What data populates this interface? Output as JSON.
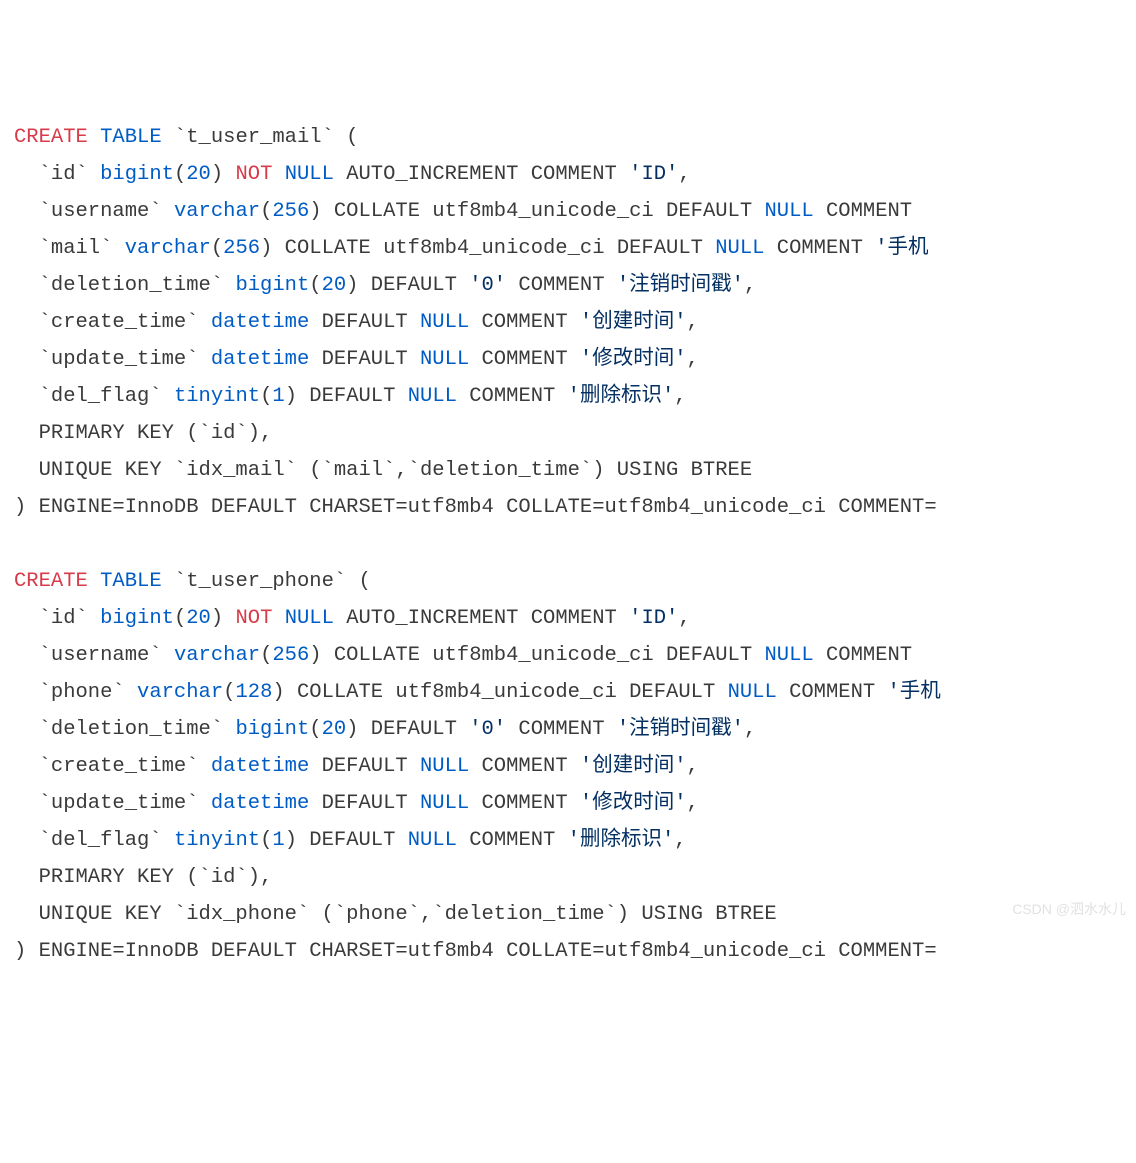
{
  "lines": [
    [
      {
        "c": "k-create",
        "t": "CREATE"
      },
      {
        "c": "plain",
        "t": " "
      },
      {
        "c": "k-blue",
        "t": "TABLE"
      },
      {
        "c": "plain",
        "t": " `t_user_mail` ("
      }
    ],
    [
      {
        "c": "plain",
        "t": "  `id` "
      },
      {
        "c": "k-blue",
        "t": "bigint"
      },
      {
        "c": "plain",
        "t": "("
      },
      {
        "c": "k-blue",
        "t": "20"
      },
      {
        "c": "plain",
        "t": ") "
      },
      {
        "c": "k-create",
        "t": "NOT"
      },
      {
        "c": "plain",
        "t": " "
      },
      {
        "c": "k-blue",
        "t": "NULL"
      },
      {
        "c": "plain",
        "t": " AUTO_INCREMENT COMMENT "
      },
      {
        "c": "k-str",
        "t": "'ID'"
      },
      {
        "c": "plain",
        "t": ","
      }
    ],
    [
      {
        "c": "plain",
        "t": "  `username` "
      },
      {
        "c": "k-blue",
        "t": "varchar"
      },
      {
        "c": "plain",
        "t": "("
      },
      {
        "c": "k-blue",
        "t": "256"
      },
      {
        "c": "plain",
        "t": ") COLLATE utf8mb4_unicode_ci DEFAULT "
      },
      {
        "c": "k-blue",
        "t": "NULL"
      },
      {
        "c": "plain",
        "t": " COMMENT "
      }
    ],
    [
      {
        "c": "plain",
        "t": "  `mail` "
      },
      {
        "c": "k-blue",
        "t": "varchar"
      },
      {
        "c": "plain",
        "t": "("
      },
      {
        "c": "k-blue",
        "t": "256"
      },
      {
        "c": "plain",
        "t": ") COLLATE utf8mb4_unicode_ci DEFAULT "
      },
      {
        "c": "k-blue",
        "t": "NULL"
      },
      {
        "c": "plain",
        "t": " COMMENT "
      },
      {
        "c": "k-str",
        "t": "'手机"
      }
    ],
    [
      {
        "c": "plain",
        "t": "  `deletion_time` "
      },
      {
        "c": "k-blue",
        "t": "bigint"
      },
      {
        "c": "plain",
        "t": "("
      },
      {
        "c": "k-blue",
        "t": "20"
      },
      {
        "c": "plain",
        "t": ") DEFAULT "
      },
      {
        "c": "k-str",
        "t": "'0'"
      },
      {
        "c": "plain",
        "t": " COMMENT "
      },
      {
        "c": "k-str",
        "t": "'注销时间戳'"
      },
      {
        "c": "plain",
        "t": ","
      }
    ],
    [
      {
        "c": "plain",
        "t": "  `create_time` "
      },
      {
        "c": "k-blue",
        "t": "datetime"
      },
      {
        "c": "plain",
        "t": " DEFAULT "
      },
      {
        "c": "k-blue",
        "t": "NULL"
      },
      {
        "c": "plain",
        "t": " COMMENT "
      },
      {
        "c": "k-str",
        "t": "'创建时间'"
      },
      {
        "c": "plain",
        "t": ","
      }
    ],
    [
      {
        "c": "plain",
        "t": "  `update_time` "
      },
      {
        "c": "k-blue",
        "t": "datetime"
      },
      {
        "c": "plain",
        "t": " DEFAULT "
      },
      {
        "c": "k-blue",
        "t": "NULL"
      },
      {
        "c": "plain",
        "t": " COMMENT "
      },
      {
        "c": "k-str",
        "t": "'修改时间'"
      },
      {
        "c": "plain",
        "t": ","
      }
    ],
    [
      {
        "c": "plain",
        "t": "  `del_flag` "
      },
      {
        "c": "k-blue",
        "t": "tinyint"
      },
      {
        "c": "plain",
        "t": "("
      },
      {
        "c": "k-blue",
        "t": "1"
      },
      {
        "c": "plain",
        "t": ") DEFAULT "
      },
      {
        "c": "k-blue",
        "t": "NULL"
      },
      {
        "c": "plain",
        "t": " COMMENT "
      },
      {
        "c": "k-str",
        "t": "'删除标识'"
      },
      {
        "c": "plain",
        "t": ","
      }
    ],
    [
      {
        "c": "plain",
        "t": "  PRIMARY KEY (`id`),"
      }
    ],
    [
      {
        "c": "plain",
        "t": "  UNIQUE KEY `idx_mail` (`mail`,`deletion_time`) USING BTREE"
      }
    ],
    [
      {
        "c": "plain",
        "t": ") ENGINE=InnoDB DEFAULT CHARSET=utf8mb4 COLLATE=utf8mb4_unicode_ci COMMENT="
      }
    ],
    [
      {
        "c": "plain",
        "t": ""
      }
    ],
    [
      {
        "c": "k-create",
        "t": "CREATE"
      },
      {
        "c": "plain",
        "t": " "
      },
      {
        "c": "k-blue",
        "t": "TABLE"
      },
      {
        "c": "plain",
        "t": " `t_user_phone` ("
      }
    ],
    [
      {
        "c": "plain",
        "t": "  `id` "
      },
      {
        "c": "k-blue",
        "t": "bigint"
      },
      {
        "c": "plain",
        "t": "("
      },
      {
        "c": "k-blue",
        "t": "20"
      },
      {
        "c": "plain",
        "t": ") "
      },
      {
        "c": "k-create",
        "t": "NOT"
      },
      {
        "c": "plain",
        "t": " "
      },
      {
        "c": "k-blue",
        "t": "NULL"
      },
      {
        "c": "plain",
        "t": " AUTO_INCREMENT COMMENT "
      },
      {
        "c": "k-str",
        "t": "'ID'"
      },
      {
        "c": "plain",
        "t": ","
      }
    ],
    [
      {
        "c": "plain",
        "t": "  `username` "
      },
      {
        "c": "k-blue",
        "t": "varchar"
      },
      {
        "c": "plain",
        "t": "("
      },
      {
        "c": "k-blue",
        "t": "256"
      },
      {
        "c": "plain",
        "t": ") COLLATE utf8mb4_unicode_ci DEFAULT "
      },
      {
        "c": "k-blue",
        "t": "NULL"
      },
      {
        "c": "plain",
        "t": " COMMENT "
      }
    ],
    [
      {
        "c": "plain",
        "t": "  `phone` "
      },
      {
        "c": "k-blue",
        "t": "varchar"
      },
      {
        "c": "plain",
        "t": "("
      },
      {
        "c": "k-blue",
        "t": "128"
      },
      {
        "c": "plain",
        "t": ") COLLATE utf8mb4_unicode_ci DEFAULT "
      },
      {
        "c": "k-blue",
        "t": "NULL"
      },
      {
        "c": "plain",
        "t": " COMMENT "
      },
      {
        "c": "k-str",
        "t": "'手机"
      }
    ],
    [
      {
        "c": "plain",
        "t": "  `deletion_time` "
      },
      {
        "c": "k-blue",
        "t": "bigint"
      },
      {
        "c": "plain",
        "t": "("
      },
      {
        "c": "k-blue",
        "t": "20"
      },
      {
        "c": "plain",
        "t": ") DEFAULT "
      },
      {
        "c": "k-str",
        "t": "'0'"
      },
      {
        "c": "plain",
        "t": " COMMENT "
      },
      {
        "c": "k-str",
        "t": "'注销时间戳'"
      },
      {
        "c": "plain",
        "t": ","
      }
    ],
    [
      {
        "c": "plain",
        "t": "  `create_time` "
      },
      {
        "c": "k-blue",
        "t": "datetime"
      },
      {
        "c": "plain",
        "t": " DEFAULT "
      },
      {
        "c": "k-blue",
        "t": "NULL"
      },
      {
        "c": "plain",
        "t": " COMMENT "
      },
      {
        "c": "k-str",
        "t": "'创建时间'"
      },
      {
        "c": "plain",
        "t": ","
      }
    ],
    [
      {
        "c": "plain",
        "t": "  `update_time` "
      },
      {
        "c": "k-blue",
        "t": "datetime"
      },
      {
        "c": "plain",
        "t": " DEFAULT "
      },
      {
        "c": "k-blue",
        "t": "NULL"
      },
      {
        "c": "plain",
        "t": " COMMENT "
      },
      {
        "c": "k-str",
        "t": "'修改时间'"
      },
      {
        "c": "plain",
        "t": ","
      }
    ],
    [
      {
        "c": "plain",
        "t": "  `del_flag` "
      },
      {
        "c": "k-blue",
        "t": "tinyint"
      },
      {
        "c": "plain",
        "t": "("
      },
      {
        "c": "k-blue",
        "t": "1"
      },
      {
        "c": "plain",
        "t": ") DEFAULT "
      },
      {
        "c": "k-blue",
        "t": "NULL"
      },
      {
        "c": "plain",
        "t": " COMMENT "
      },
      {
        "c": "k-str",
        "t": "'删除标识'"
      },
      {
        "c": "plain",
        "t": ","
      }
    ],
    [
      {
        "c": "plain",
        "t": "  PRIMARY KEY (`id`),"
      }
    ],
    [
      {
        "c": "plain",
        "t": "  UNIQUE KEY `idx_phone` (`phone`,`deletion_time`) USING BTREE"
      }
    ],
    [
      {
        "c": "plain",
        "t": ") ENGINE=InnoDB DEFAULT CHARSET=utf8mb4 COLLATE=utf8mb4_unicode_ci COMMENT="
      }
    ]
  ],
  "watermark": "CSDN @泗水水儿"
}
